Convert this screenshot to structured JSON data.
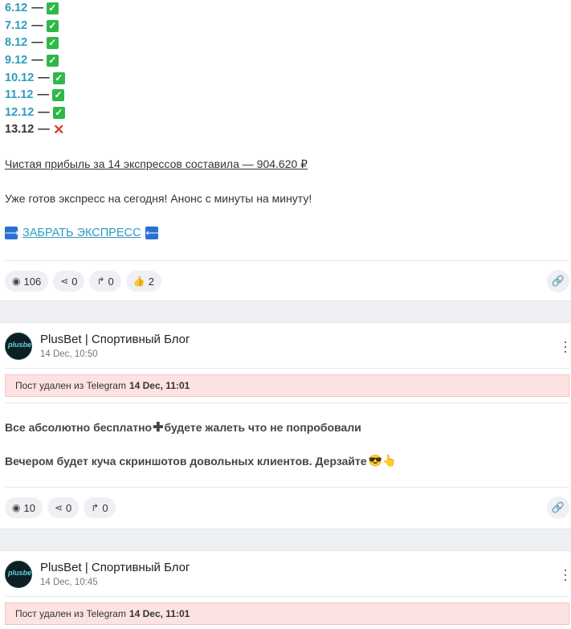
{
  "post1": {
    "results": [
      {
        "date": "6.12",
        "sep": "—",
        "status": "ok"
      },
      {
        "date": "7.12",
        "sep": "—",
        "status": "ok"
      },
      {
        "date": "8.12",
        "sep": "—",
        "status": "ok"
      },
      {
        "date": "9.12",
        "sep": "—",
        "status": "ok"
      },
      {
        "date": "10.12",
        "sep": "—",
        "status": "ok"
      },
      {
        "date": "11.12",
        "sep": "—",
        "status": "ok"
      },
      {
        "date": "12.12",
        "sep": "—",
        "status": "ok"
      },
      {
        "date": "13.12",
        "sep": "—",
        "status": "fail"
      }
    ],
    "profit_text": "Чистая прибыль за 14 экспрессов составила — 904.620 ₽",
    "today_text": "Уже готов экспресс на сегодня! Анонс с минуты на минуту!",
    "express_link": "ЗАБРАТЬ ЭКСПРЕСС",
    "stats": {
      "views": "106",
      "shares": "0",
      "forwards": "0",
      "likes": "2"
    }
  },
  "post2": {
    "channel": "PlusBet | Спортивный Блог",
    "time": "14 Dec, 10:50",
    "deleted_prefix": "Пост удален из Telegram",
    "deleted_time": "14 Dec, 11:01",
    "line1_a": "Все абсолютно бесплатно",
    "line1_b": "будете жалеть что не попробовали",
    "line2": "Вечером будет куча скриншотов довольных клиентов. Дерзайте",
    "stats": {
      "views": "10",
      "shares": "0",
      "forwards": "0"
    }
  },
  "post3": {
    "channel": "PlusBet | Спортивный Блог",
    "time": "14 Dec, 10:45",
    "deleted_prefix": "Пост удален из Telegram",
    "deleted_time": "14 Dec, 11:01"
  },
  "avatar_text": "plusbet",
  "icons": {
    "check": "✓",
    "cross": "✕",
    "eye": "◉",
    "share": "⋖",
    "forward": "↱",
    "like": "👍",
    "link": "🔗"
  }
}
